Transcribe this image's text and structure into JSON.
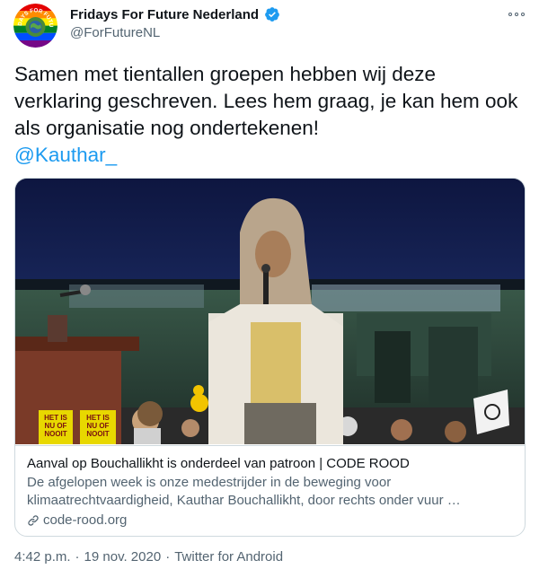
{
  "author": {
    "display_name": "Fridays For Future Nederland",
    "handle": "@ForFutureNL",
    "avatar_text": "FRIDAYS FOR FUTURE",
    "verified": true
  },
  "tweet": {
    "text": "Samen met tientallen groepen hebben wij deze verklaring geschreven. Lees hem graag, je kan hem ook als organisatie nog ondertekenen!",
    "mention": "@Kauthar_"
  },
  "link_card": {
    "title": "Aanval op Bouchallikht is onderdeel van patroon | CODE ROOD",
    "description": "De afgelopen week is onze medestrijder in de beweging voor klimaatrechtvaardigheid, Kauthar Bouchallikht, door rechts onder vuur …",
    "domain": "code-rood.org",
    "image_signs": [
      "HET IS NU OF NOOIT",
      "HET IS NU OF NOOIT"
    ]
  },
  "footer": {
    "time": "4:42 p.m.",
    "date": "19 nov. 2020",
    "source": "Twitter for Android",
    "separator": "·"
  },
  "colors": {
    "link": "#1d9bf0",
    "secondary_text": "#536471",
    "primary_text": "#0f1419",
    "border": "#cfd9de",
    "verified": "#1d9bf0"
  },
  "icons": [
    "verified-badge-icon",
    "more-options-icon",
    "link-icon"
  ]
}
